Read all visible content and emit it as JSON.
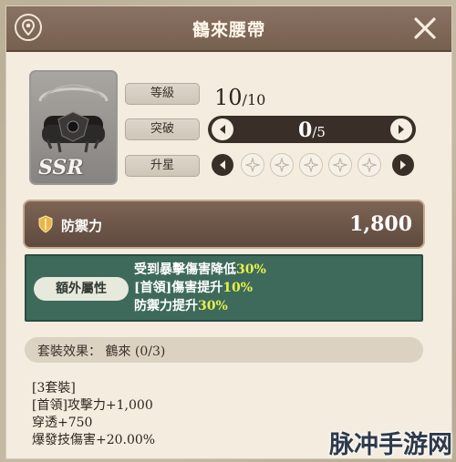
{
  "header": {
    "title": "鶴來腰帶"
  },
  "item": {
    "rarity": "SSR"
  },
  "stats": {
    "level_label": "等級",
    "level_value": "10",
    "level_max": "/10",
    "breakthrough_label": "突破",
    "breakthrough_value": "0",
    "breakthrough_max": "/5",
    "upgrade_label": "升星",
    "stars_filled": 0,
    "stars_total": 5
  },
  "defense": {
    "label": "防禦力",
    "value": "1,800"
  },
  "extra": {
    "label": "額外屬性",
    "lines": [
      {
        "text": "受到暴擊傷害降低",
        "value": "30%"
      },
      {
        "text": "[首領]傷害提升",
        "value": "10%"
      },
      {
        "text": "防禦力提升",
        "value": "30%"
      }
    ]
  },
  "set": {
    "title": "套裝效果： 鶴來 (0/3)",
    "lines": [
      "[3套裝]",
      "[首領]攻擊力+1,000",
      "穿透+750",
      "爆發技傷害+20.00%"
    ]
  },
  "watermark": "脉冲手游网",
  "colors": {
    "accent_green": "#3d6a5b",
    "highlight": "#e6f04a",
    "header": "#7c6656"
  }
}
